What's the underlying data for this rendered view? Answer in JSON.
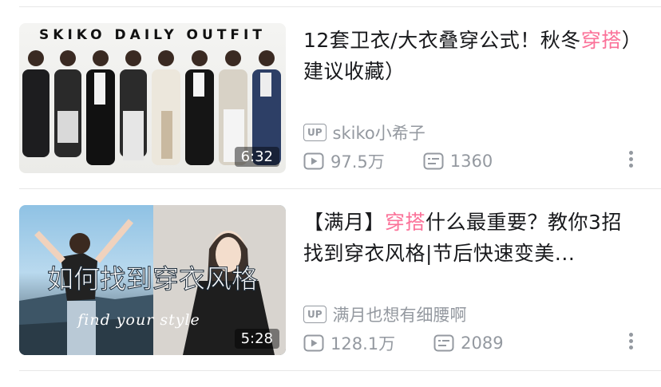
{
  "videos": [
    {
      "thumbnail": {
        "overlay_text": "SKIKO DAILY OUTFIT"
      },
      "duration": "6:32",
      "title_parts": [
        {
          "text": "12套卫衣/大衣叠穿公式！秋冬",
          "highlight": false
        },
        {
          "text": "穿搭",
          "highlight": true
        },
        {
          "text": "）建议收藏）",
          "highlight": false
        }
      ],
      "uploader_badge": "UP",
      "uploader": "skiko小希子",
      "views": "97.5万",
      "comments": "1360"
    },
    {
      "thumbnail": {
        "overlay_text": "如何找到穿衣风格",
        "script_text": "find your style"
      },
      "duration": "5:28",
      "title_parts": [
        {
          "text": "【满月】",
          "highlight": false
        },
        {
          "text": "穿搭",
          "highlight": true
        },
        {
          "text": "什么最重要？教你3招找到穿衣风格|节后快速变美...",
          "highlight": false
        }
      ],
      "uploader_badge": "UP",
      "uploader": "满月也想有细腰啊",
      "views": "128.1万",
      "comments": "2089"
    }
  ],
  "colors": {
    "highlight": "#fb7299",
    "meta": "#9499a0",
    "title": "#18191c"
  },
  "icons": [
    "up-badge-icon",
    "play-count-icon",
    "danmaku-icon",
    "more-vertical-icon"
  ]
}
